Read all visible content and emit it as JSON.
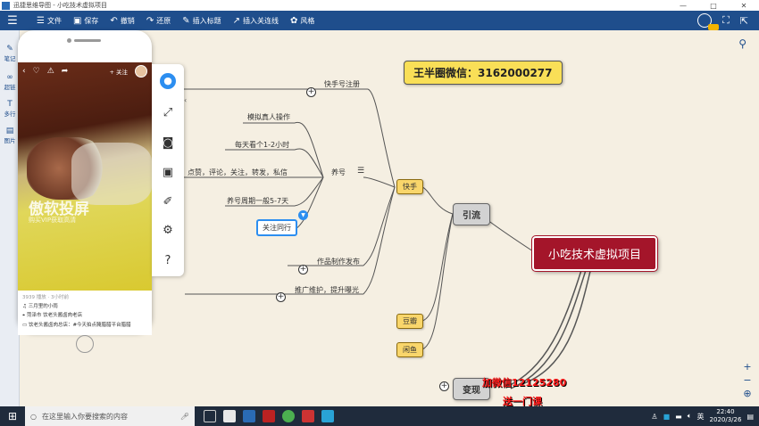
{
  "window": {
    "title": "迅捷思维导图 - 小吃技术虚拟项目",
    "controls": [
      "—",
      "□",
      "✕"
    ]
  },
  "toolbar": {
    "items": [
      {
        "icon": "file-icon",
        "label": "文件"
      },
      {
        "icon": "save-icon",
        "label": "保存"
      },
      {
        "icon": "undo-icon",
        "label": "撤销"
      },
      {
        "icon": "redo-icon",
        "label": "还原"
      },
      {
        "icon": "insert-topic-icon",
        "label": "插入标题"
      },
      {
        "icon": "insert-link-icon",
        "label": "插入关连线"
      },
      {
        "icon": "style-icon",
        "label": "风格"
      }
    ]
  },
  "sidebar": {
    "items": [
      {
        "icon": "pen-icon",
        "label": "笔记"
      },
      {
        "icon": "link-icon",
        "label": "超链"
      },
      {
        "icon": "text-icon",
        "label": "多行"
      },
      {
        "icon": "image-icon",
        "label": "图片"
      }
    ]
  },
  "mindmap": {
    "root": "小吃技术虚拟项目",
    "wechat_box": "王半圈微信：3162000277",
    "branch_yinliu": "引流",
    "branch_bianxian": "变现",
    "kuaishou": "快手",
    "douban": "豆瓣",
    "xianyu": "闲鱼",
    "kuaishou_register": "快手号注册",
    "yanghao": "养号",
    "sim_operation": "模拟真人操作",
    "daily_watch": "每天看个1-2小时",
    "interactions": "点赞，评论，关注，转发，私信",
    "yanghao_cycle": "养号周期一般5-7天",
    "follow_peers": "关注同行",
    "works_publish": "作品制作发布",
    "promotion": "推广维护，提升曝光"
  },
  "overlay": {
    "line1": "加微信12125280",
    "line2": "送一门课"
  },
  "phone": {
    "follow": "+ 关注",
    "watermark": "傲软投屏",
    "watermark_sub": "购买VIP获取高清",
    "meta": "3939 播放 · 3小时前",
    "music": "三月里的小雨",
    "location": "菏泽市 饮老头酱卤肉老店",
    "desc": "饮老头酱卤肉总店：#今天拍点腌腊腊平台腊腊"
  },
  "taskbar": {
    "search_placeholder": "在这里输入你要搜索的内容",
    "lang": "英",
    "time": "22:40",
    "date": "2020/3/26"
  }
}
